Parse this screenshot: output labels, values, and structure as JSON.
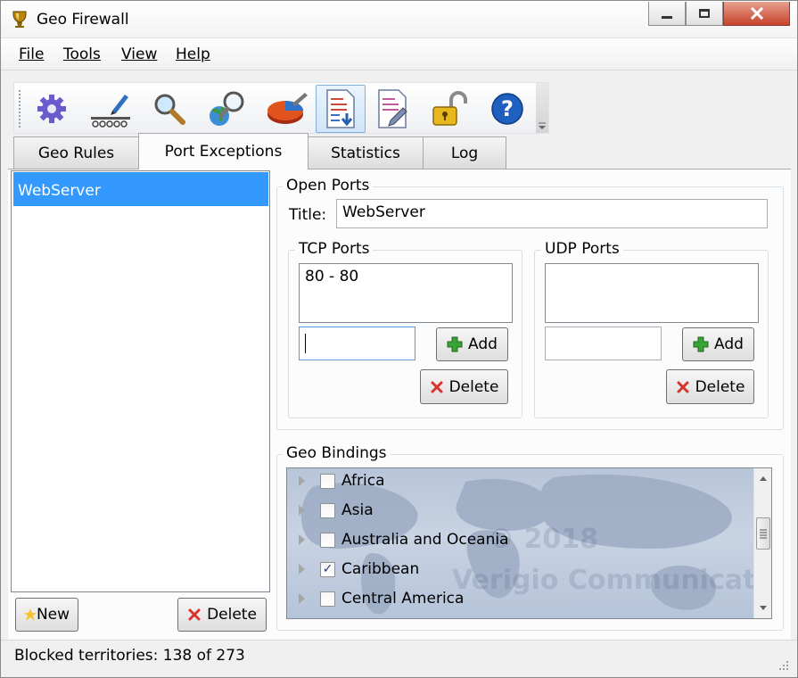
{
  "window": {
    "title": "Geo Firewall"
  },
  "menu": [
    {
      "label": "File"
    },
    {
      "label": "Tools"
    },
    {
      "label": "View"
    },
    {
      "label": "Help"
    }
  ],
  "toolbar": {
    "icons": [
      "settings-gear-icon",
      "edit-rules-icon",
      "search-icon",
      "globe-lookup-icon",
      "statistics-pie-chart-icon",
      "import-list-icon",
      "export-list-icon",
      "unlock-padlock-icon",
      "help-icon"
    ],
    "active_index": 5
  },
  "tabs": [
    {
      "label": "Geo Rules"
    },
    {
      "label": "Port Exceptions",
      "selected": true
    },
    {
      "label": "Statistics"
    },
    {
      "label": "Log"
    }
  ],
  "exceptions": {
    "items": [
      "WebServer"
    ],
    "new_label": "New",
    "delete_label": "Delete"
  },
  "open_ports": {
    "group_label": "Open Ports",
    "title_label": "Title:",
    "title_value": "WebServer",
    "tcp": {
      "group_label": "TCP Ports",
      "entries": [
        "80 - 80"
      ],
      "input_value": "",
      "add_label": "Add",
      "delete_label": "Delete"
    },
    "udp": {
      "group_label": "UDP Ports",
      "entries": [],
      "input_value": "",
      "add_label": "Add",
      "delete_label": "Delete"
    }
  },
  "geo_bindings": {
    "group_label": "Geo Bindings",
    "items": [
      {
        "label": "Africa",
        "checked": false
      },
      {
        "label": "Asia",
        "checked": false
      },
      {
        "label": "Australia and Oceania",
        "checked": false
      },
      {
        "label": "Caribbean",
        "checked": true
      },
      {
        "label": "Central America",
        "checked": false
      }
    ],
    "watermark_line1": "© 2018",
    "watermark_line2": "Verigio Communications Inc."
  },
  "status": {
    "text": "Blocked territories: 138 of 273"
  },
  "colors": {
    "selection": "#3399ff",
    "add_green": "#3aa335",
    "delete_red": "#d9342b",
    "help_blue": "#1f5fc0"
  }
}
